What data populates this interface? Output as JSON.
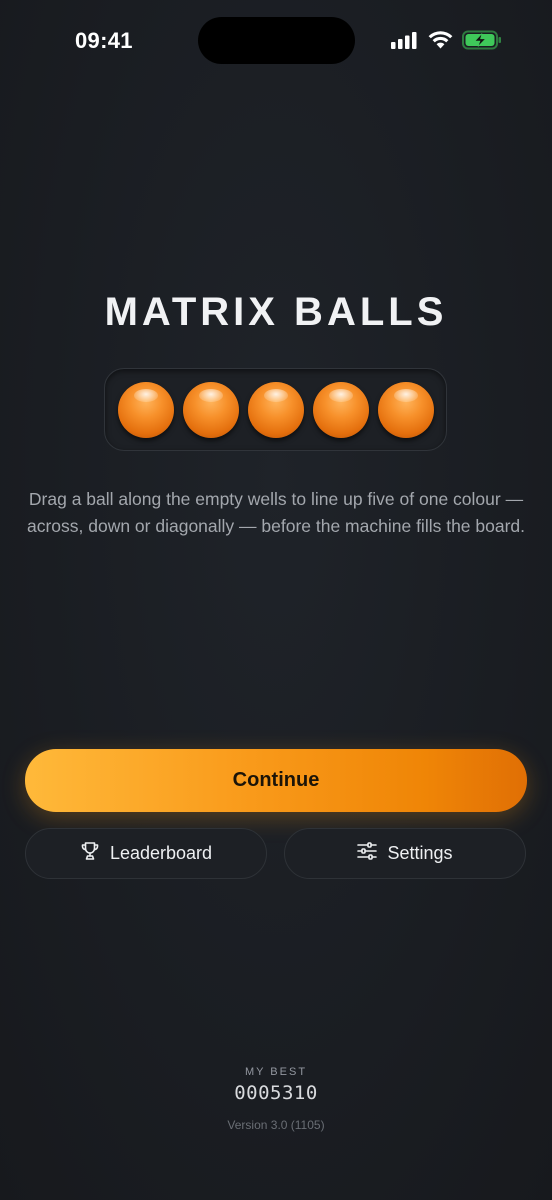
{
  "status_bar": {
    "time": "09:41",
    "icons": [
      "signal-icon",
      "wifi-icon",
      "battery-charging-icon"
    ],
    "battery_color": "#3fc85a"
  },
  "game": {
    "title": "MATRIX BALLS",
    "balls": [
      "orange",
      "orange",
      "orange",
      "orange",
      "orange"
    ],
    "ball_color": "#f7902a",
    "description": "Drag a ball along the empty wells to line up five of one colour — across, down or diagonally — before the machine fills the board."
  },
  "actions": {
    "continue_label": "Continue",
    "leaderboard_label": "Leaderboard",
    "leaderboard_icon": "trophy-icon",
    "settings_label": "Settings",
    "settings_icon": "sliders-icon",
    "accent": "#f99a1a"
  },
  "footer": {
    "best_label": "MY BEST",
    "best_value": "0005310",
    "version": "Version 3.0 (1105)"
  }
}
